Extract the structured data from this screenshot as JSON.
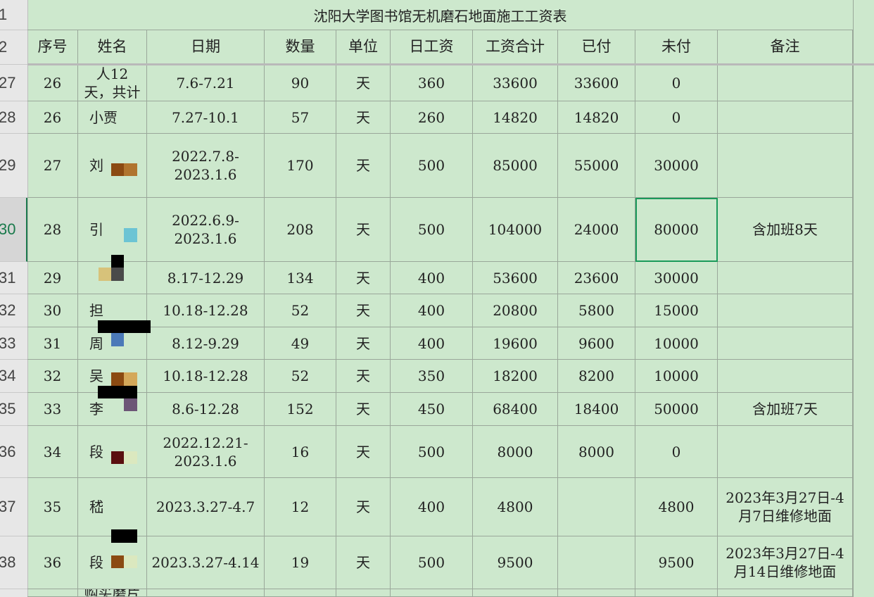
{
  "sheet": {
    "title": "沈阳大学图书馆无机磨石地面施工工资表",
    "title_row_number": "1",
    "header_row_number": "2",
    "headers": [
      "序号",
      "姓名",
      "日期",
      "数量",
      "单位",
      "日工资",
      "工资合计",
      "已付",
      "未付",
      "备注"
    ],
    "rows": [
      {
        "row_number": "27",
        "cells": [
          "26",
          "人12\n天，共计",
          "7.6-7.21",
          "90",
          "天",
          "360",
          "33600",
          "33600",
          "0",
          ""
        ]
      },
      {
        "row_number": "28",
        "cells": [
          "26",
          "小贾",
          "7.27-10.1",
          "57",
          "天",
          "260",
          "14820",
          "14820",
          "0",
          ""
        ]
      },
      {
        "row_number": "29",
        "cells": [
          "27",
          "刘",
          "2022.7.8-\n2023.1.6",
          "170",
          "天",
          "500",
          "85000",
          "55000",
          "30000",
          ""
        ]
      },
      {
        "row_number": "30",
        "cells": [
          "28",
          "引",
          "2022.6.9-\n2023.1.6",
          "208",
          "天",
          "500",
          "104000",
          "24000",
          "80000",
          "含加班8天"
        ]
      },
      {
        "row_number": "31",
        "cells": [
          "29",
          "",
          "8.17-12.29",
          "134",
          "天",
          "400",
          "53600",
          "23600",
          "30000",
          ""
        ]
      },
      {
        "row_number": "32",
        "cells": [
          "30",
          "担",
          "10.18-12.28",
          "52",
          "天",
          "400",
          "20800",
          "5800",
          "15000",
          ""
        ]
      },
      {
        "row_number": "33",
        "cells": [
          "31",
          "周",
          "8.12-9.29",
          "49",
          "天",
          "400",
          "19600",
          "9600",
          "10000",
          ""
        ]
      },
      {
        "row_number": "34",
        "cells": [
          "32",
          "吴",
          "10.18-12.28",
          "52",
          "天",
          "350",
          "18200",
          "8200",
          "10000",
          ""
        ]
      },
      {
        "row_number": "35",
        "cells": [
          "33",
          "李",
          "8.6-12.28",
          "152",
          "天",
          "450",
          "68400",
          "18400",
          "50000",
          "含加班7天"
        ]
      },
      {
        "row_number": "36",
        "cells": [
          "34",
          "段",
          "2022.12.21-\n2023.1.6",
          "16",
          "天",
          "500",
          "8000",
          "8000",
          "0",
          ""
        ]
      },
      {
        "row_number": "37",
        "cells": [
          "35",
          "嵇",
          "2023.3.27-4.7",
          "12",
          "天",
          "400",
          "4800",
          "",
          "4800",
          "2023年3月27日-4\n月7日维修地面"
        ]
      },
      {
        "row_number": "38",
        "cells": [
          "36",
          "段",
          "2023.3.27-4.14",
          "19",
          "天",
          "500",
          "9500",
          "",
          "9500",
          "2023年3月27日-4\n月14日维修地面"
        ]
      },
      {
        "row_number": "",
        "cells": [
          "",
          "购买磨片",
          "",
          "",
          "",
          "",
          "",
          "",
          "",
          ""
        ]
      }
    ],
    "selected_cell": {
      "row": "30",
      "column": "未付"
    },
    "colors": {
      "cell_fill": "#cde8cd",
      "grid": "#9aa79a",
      "selection": "#1a9a5a",
      "redaction": "#000000"
    }
  }
}
